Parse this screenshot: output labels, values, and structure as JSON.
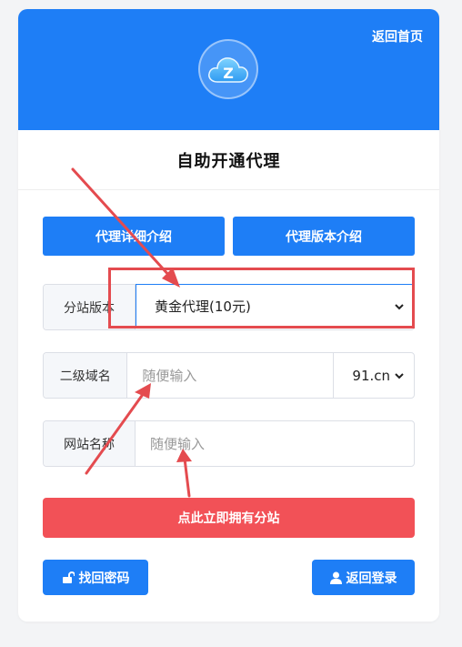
{
  "header": {
    "home_link": "返回首页",
    "logo_icon": "cloud-icon",
    "logo_letter": "Z"
  },
  "page_title": "自助开通代理",
  "buttons": {
    "agent_intro": "代理详细介绍",
    "version_intro": "代理版本介绍",
    "submit": "点此立即拥有分站",
    "find_password": "找回密码",
    "back_login": "返回登录"
  },
  "form": {
    "version": {
      "label": "分站版本",
      "selected": "黄金代理(10元)"
    },
    "subdomain": {
      "label": "二级域名",
      "placeholder": "随便输入",
      "suffix": "91.cn"
    },
    "site_name": {
      "label": "网站名称",
      "placeholder": "随便输入"
    }
  },
  "colors": {
    "primary": "#1e7ef6",
    "danger": "#f25157",
    "annotation": "#e44b4f"
  }
}
